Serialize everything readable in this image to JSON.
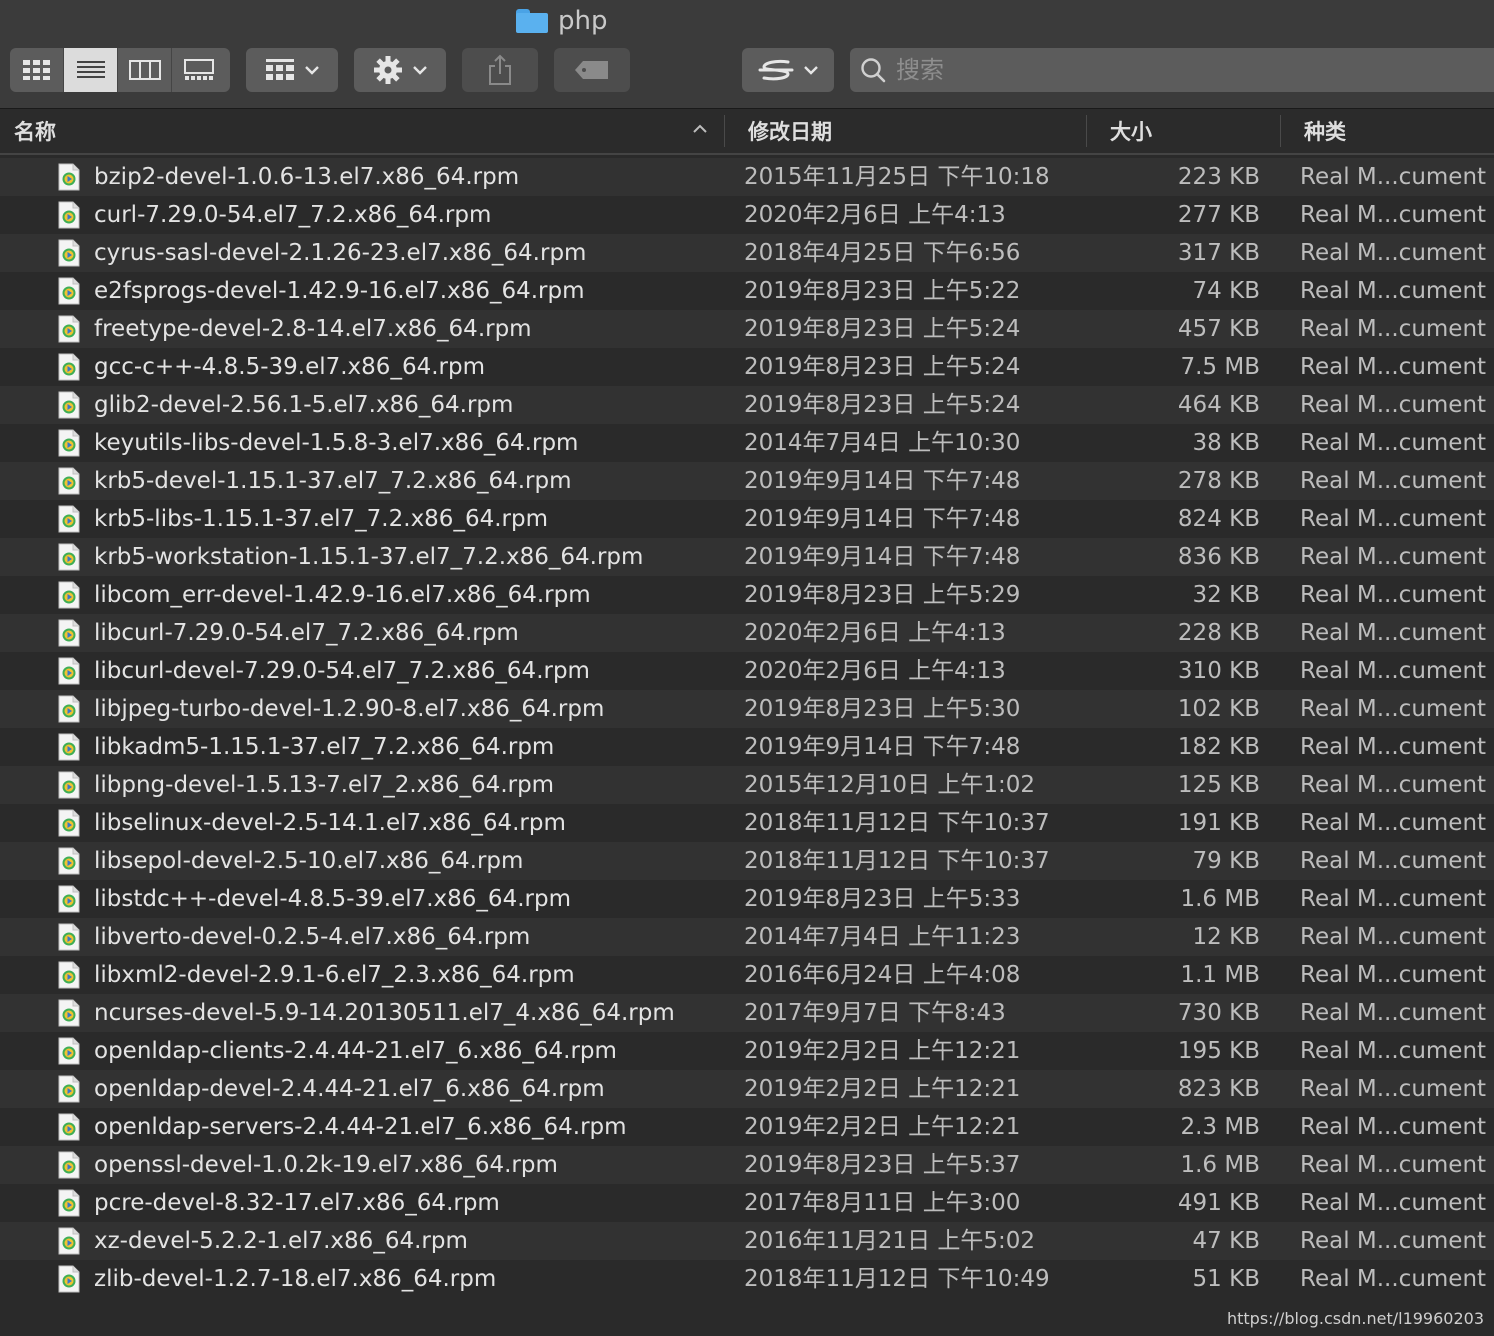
{
  "window": {
    "title": "php",
    "folder_icon": "folder-icon"
  },
  "toolbar": {
    "view_modes": [
      "icon-view",
      "list-view",
      "column-view",
      "gallery-view"
    ],
    "active_view": "list-view",
    "group_button_icon": "grid-icon",
    "action_button_icon": "gear-icon",
    "share_button_icon": "share-icon",
    "tag_button_icon": "tag-icon",
    "path_button_icon": "path-icon"
  },
  "search": {
    "placeholder": "搜索",
    "value": ""
  },
  "columns": {
    "name": "名称",
    "date": "修改日期",
    "size": "大小",
    "kind": "种类"
  },
  "files": [
    {
      "name": "bzip2-devel-1.0.6-13.el7.x86_64.rpm",
      "date": "2015年11月25日 下午10:18",
      "size": "223 KB",
      "kind": "Real M...cument"
    },
    {
      "name": "curl-7.29.0-54.el7_7.2.x86_64.rpm",
      "date": "2020年2月6日 上午4:13",
      "size": "277 KB",
      "kind": "Real M...cument"
    },
    {
      "name": "cyrus-sasl-devel-2.1.26-23.el7.x86_64.rpm",
      "date": "2018年4月25日 下午6:56",
      "size": "317 KB",
      "kind": "Real M...cument"
    },
    {
      "name": "e2fsprogs-devel-1.42.9-16.el7.x86_64.rpm",
      "date": "2019年8月23日 上午5:22",
      "size": "74 KB",
      "kind": "Real M...cument"
    },
    {
      "name": "freetype-devel-2.8-14.el7.x86_64.rpm",
      "date": "2019年8月23日 上午5:24",
      "size": "457 KB",
      "kind": "Real M...cument"
    },
    {
      "name": "gcc-c++-4.8.5-39.el7.x86_64.rpm",
      "date": "2019年8月23日 上午5:24",
      "size": "7.5 MB",
      "kind": "Real M...cument"
    },
    {
      "name": "glib2-devel-2.56.1-5.el7.x86_64.rpm",
      "date": "2019年8月23日 上午5:24",
      "size": "464 KB",
      "kind": "Real M...cument"
    },
    {
      "name": "keyutils-libs-devel-1.5.8-3.el7.x86_64.rpm",
      "date": "2014年7月4日 上午10:30",
      "size": "38 KB",
      "kind": "Real M...cument"
    },
    {
      "name": "krb5-devel-1.15.1-37.el7_7.2.x86_64.rpm",
      "date": "2019年9月14日 下午7:48",
      "size": "278 KB",
      "kind": "Real M...cument"
    },
    {
      "name": "krb5-libs-1.15.1-37.el7_7.2.x86_64.rpm",
      "date": "2019年9月14日 下午7:48",
      "size": "824 KB",
      "kind": "Real M...cument"
    },
    {
      "name": "krb5-workstation-1.15.1-37.el7_7.2.x86_64.rpm",
      "date": "2019年9月14日 下午7:48",
      "size": "836 KB",
      "kind": "Real M...cument"
    },
    {
      "name": "libcom_err-devel-1.42.9-16.el7.x86_64.rpm",
      "date": "2019年8月23日 上午5:29",
      "size": "32 KB",
      "kind": "Real M...cument"
    },
    {
      "name": "libcurl-7.29.0-54.el7_7.2.x86_64.rpm",
      "date": "2020年2月6日 上午4:13",
      "size": "228 KB",
      "kind": "Real M...cument"
    },
    {
      "name": "libcurl-devel-7.29.0-54.el7_7.2.x86_64.rpm",
      "date": "2020年2月6日 上午4:13",
      "size": "310 KB",
      "kind": "Real M...cument"
    },
    {
      "name": "libjpeg-turbo-devel-1.2.90-8.el7.x86_64.rpm",
      "date": "2019年8月23日 上午5:30",
      "size": "102 KB",
      "kind": "Real M...cument"
    },
    {
      "name": "libkadm5-1.15.1-37.el7_7.2.x86_64.rpm",
      "date": "2019年9月14日 下午7:48",
      "size": "182 KB",
      "kind": "Real M...cument"
    },
    {
      "name": "libpng-devel-1.5.13-7.el7_2.x86_64.rpm",
      "date": "2015年12月10日 上午1:02",
      "size": "125 KB",
      "kind": "Real M...cument"
    },
    {
      "name": "libselinux-devel-2.5-14.1.el7.x86_64.rpm",
      "date": "2018年11月12日 下午10:37",
      "size": "191 KB",
      "kind": "Real M...cument"
    },
    {
      "name": "libsepol-devel-2.5-10.el7.x86_64.rpm",
      "date": "2018年11月12日 下午10:37",
      "size": "79 KB",
      "kind": "Real M...cument"
    },
    {
      "name": "libstdc++-devel-4.8.5-39.el7.x86_64.rpm",
      "date": "2019年8月23日 上午5:33",
      "size": "1.6 MB",
      "kind": "Real M...cument"
    },
    {
      "name": "libverto-devel-0.2.5-4.el7.x86_64.rpm",
      "date": "2014年7月4日 上午11:23",
      "size": "12 KB",
      "kind": "Real M...cument"
    },
    {
      "name": "libxml2-devel-2.9.1-6.el7_2.3.x86_64.rpm",
      "date": "2016年6月24日 上午4:08",
      "size": "1.1 MB",
      "kind": "Real M...cument"
    },
    {
      "name": "ncurses-devel-5.9-14.20130511.el7_4.x86_64.rpm",
      "date": "2017年9月7日 下午8:43",
      "size": "730 KB",
      "kind": "Real M...cument"
    },
    {
      "name": "openldap-clients-2.4.44-21.el7_6.x86_64.rpm",
      "date": "2019年2月2日 上午12:21",
      "size": "195 KB",
      "kind": "Real M...cument"
    },
    {
      "name": "openldap-devel-2.4.44-21.el7_6.x86_64.rpm",
      "date": "2019年2月2日 上午12:21",
      "size": "823 KB",
      "kind": "Real M...cument"
    },
    {
      "name": "openldap-servers-2.4.44-21.el7_6.x86_64.rpm",
      "date": "2019年2月2日 上午12:21",
      "size": "2.3 MB",
      "kind": "Real M...cument"
    },
    {
      "name": "openssl-devel-1.0.2k-19.el7.x86_64.rpm",
      "date": "2019年8月23日 上午5:37",
      "size": "1.6 MB",
      "kind": "Real M...cument"
    },
    {
      "name": "pcre-devel-8.32-17.el7.x86_64.rpm",
      "date": "2017年8月11日 上午3:00",
      "size": "491 KB",
      "kind": "Real M...cument"
    },
    {
      "name": "xz-devel-5.2.2-1.el7.x86_64.rpm",
      "date": "2016年11月21日 上午5:02",
      "size": "47 KB",
      "kind": "Real M...cument"
    },
    {
      "name": "zlib-devel-1.2.7-18.el7.x86_64.rpm",
      "date": "2018年11月12日 下午10:49",
      "size": "51 KB",
      "kind": "Real M...cument"
    }
  ],
  "watermark": "https://blog.csdn.net/l19960203"
}
